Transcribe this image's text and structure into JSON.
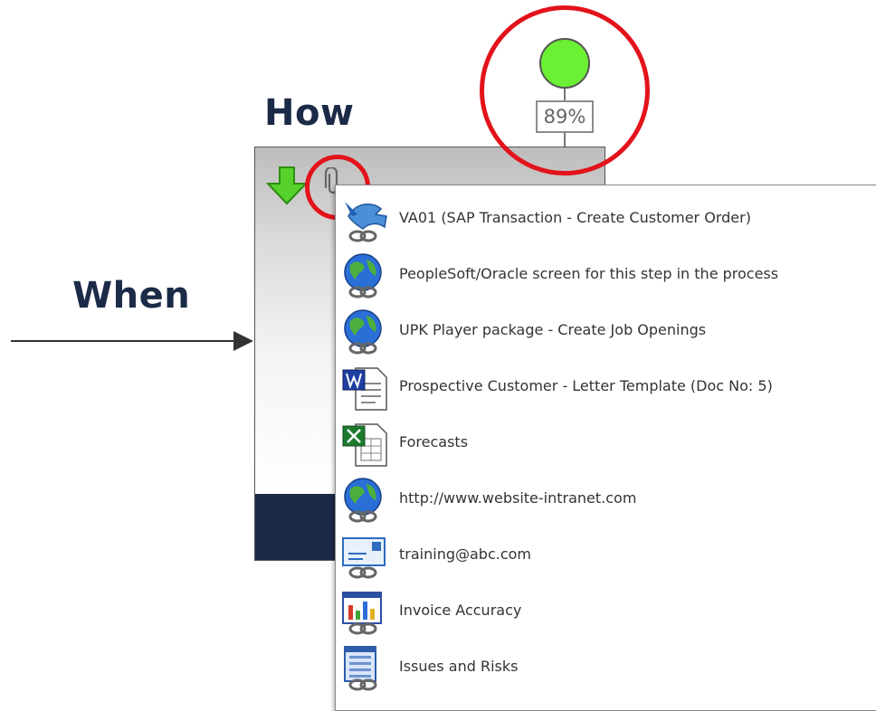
{
  "headings": {
    "how": "How",
    "when": "When"
  },
  "status": {
    "percent": "89%",
    "color": "#6bf034"
  },
  "highlight_color": "#e3131b",
  "attachments": [
    {
      "label": "VA01  (SAP Transaction - Create Customer Order)",
      "icon": "sap-transaction-link-icon"
    },
    {
      "label": "PeopleSoft/Oracle screen for this step in the process",
      "icon": "globe-link-icon"
    },
    {
      "label": "UPK Player package - Create Job Openings",
      "icon": "globe-link-icon"
    },
    {
      "label": "Prospective Customer - Letter Template (Doc No: 5)",
      "icon": "word-document-icon"
    },
    {
      "label": "Forecasts",
      "icon": "excel-spreadsheet-icon"
    },
    {
      "label": "http://www.website-intranet.com",
      "icon": "globe-link-icon"
    },
    {
      "label": "training@abc.com",
      "icon": "email-link-icon"
    },
    {
      "label": "Invoice Accuracy",
      "icon": "chart-report-link-icon"
    },
    {
      "label": "Issues and Risks",
      "icon": "document-list-link-icon"
    }
  ]
}
